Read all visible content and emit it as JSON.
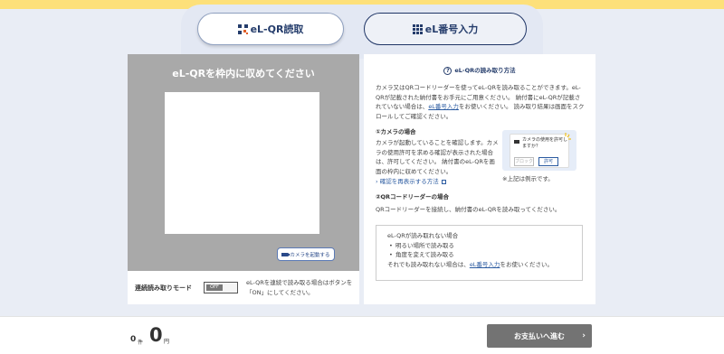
{
  "tabs": {
    "qr_read": {
      "label": "eL-QR読取",
      "icon": "qr-code-icon"
    },
    "number_input": {
      "label": "eL番号入力",
      "icon": "number-grid-icon"
    }
  },
  "camera": {
    "overlay_title": "eL-QRを枠内に収めてください",
    "start_button": "カメラを起動する",
    "continuous_label": "連続読み取りモード",
    "toggle_state": "OFF",
    "continuous_desc": "eL-QRを連続で読み取る場合はボタンを「ON」にしてください。"
  },
  "help": {
    "title": "eL-QRの読み取り方法",
    "intro_before": "カメラ又はQRコードリーダーを使ってeL-QRを読み取ることができます。eL-QRが記載された納付書をお手元にご用意ください。 納付書にeL-QRが記載されていない場合は、",
    "intro_link": "eL番号入力",
    "intro_after": "をお使いください。 読み取り結果は画面をスクロールしてご確認ください。",
    "camera_heading": "①カメラの場合",
    "camera_desc": "カメラが起動していることを確認します。カメラの使用許可を求める確認が表示された場合は、許可してください。 納付書のeL-QRを画面の枠内に収めてください。",
    "recheck_link": "確認を再表示する方法",
    "example_dialog_text": "カメラの使用を許可しますか？",
    "example_block": "ブロック",
    "example_allow": "許可",
    "example_note": "※上記は例示です。",
    "reader_heading": "②QRコードリーダーの場合",
    "reader_desc": "QRコードリーダーを接続し、納付書のeL-QRを読み取ってください。",
    "note_title": "eL-QRが読み取れない場合",
    "note_items": [
      "明るい場所で読み取る",
      "角度を変えて読み取る"
    ],
    "note_footer_before": "それでも読み取れない場合は、",
    "note_footer_link": "eL番号入力",
    "note_footer_after": "をお使いください。"
  },
  "footer": {
    "count": "0",
    "count_unit": "件",
    "amount": "0",
    "amount_unit": "円",
    "pay_button": "お支払いへ進む"
  },
  "colors": {
    "top_band": "#fde07a",
    "primary_navy": "#243c6b",
    "link": "#2a5aa0",
    "camera_bg": "#a9a9a9",
    "pay_button": "#737373"
  }
}
